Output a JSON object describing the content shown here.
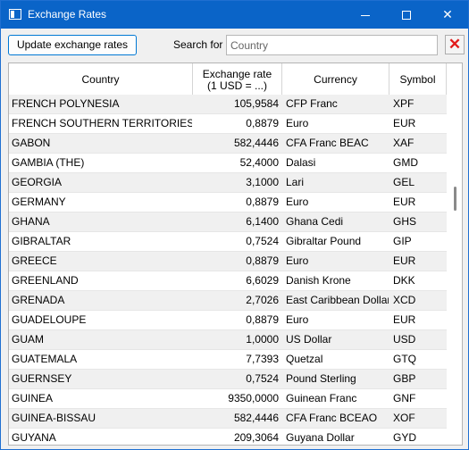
{
  "window": {
    "title": "Exchange Rates"
  },
  "toolbar": {
    "update_label": "Update exchange rates",
    "search_label": "Search for",
    "search_placeholder": "Country",
    "search_value": ""
  },
  "table": {
    "headers": {
      "country": "Country",
      "rate_line1": "Exchange rate",
      "rate_line2": "(1 USD = ...)",
      "currency": "Currency",
      "symbol": "Symbol"
    },
    "rows": [
      {
        "country": "FRENCH POLYNESIA",
        "rate": "105,9584",
        "currency": "CFP Franc",
        "symbol": "XPF"
      },
      {
        "country": "FRENCH SOUTHERN TERRITORIES (THE)",
        "rate": "0,8879",
        "currency": "Euro",
        "symbol": "EUR"
      },
      {
        "country": "GABON",
        "rate": "582,4446",
        "currency": "CFA Franc BEAC",
        "symbol": "XAF"
      },
      {
        "country": "GAMBIA (THE)",
        "rate": "52,4000",
        "currency": "Dalasi",
        "symbol": "GMD"
      },
      {
        "country": "GEORGIA",
        "rate": "3,1000",
        "currency": "Lari",
        "symbol": "GEL"
      },
      {
        "country": "GERMANY",
        "rate": "0,8879",
        "currency": "Euro",
        "symbol": "EUR"
      },
      {
        "country": "GHANA",
        "rate": "6,1400",
        "currency": "Ghana Cedi",
        "symbol": "GHS"
      },
      {
        "country": "GIBRALTAR",
        "rate": "0,7524",
        "currency": "Gibraltar Pound",
        "symbol": "GIP"
      },
      {
        "country": "GREECE",
        "rate": "0,8879",
        "currency": "Euro",
        "symbol": "EUR"
      },
      {
        "country": "GREENLAND",
        "rate": "6,6029",
        "currency": "Danish Krone",
        "symbol": "DKK"
      },
      {
        "country": "GRENADA",
        "rate": "2,7026",
        "currency": "East Caribbean Dollar",
        "symbol": "XCD"
      },
      {
        "country": "GUADELOUPE",
        "rate": "0,8879",
        "currency": "Euro",
        "symbol": "EUR"
      },
      {
        "country": "GUAM",
        "rate": "1,0000",
        "currency": "US Dollar",
        "symbol": "USD"
      },
      {
        "country": "GUATEMALA",
        "rate": "7,7393",
        "currency": "Quetzal",
        "symbol": "GTQ"
      },
      {
        "country": "GUERNSEY",
        "rate": "0,7524",
        "currency": "Pound Sterling",
        "symbol": "GBP"
      },
      {
        "country": "GUINEA",
        "rate": "9350,0000",
        "currency": "Guinean Franc",
        "symbol": "GNF"
      },
      {
        "country": "GUINEA-BISSAU",
        "rate": "582,4446",
        "currency": "CFA Franc BCEAO",
        "symbol": "XOF"
      },
      {
        "country": "GUYANA",
        "rate": "209,3064",
        "currency": "Guyana Dollar",
        "symbol": "GYD"
      }
    ]
  }
}
